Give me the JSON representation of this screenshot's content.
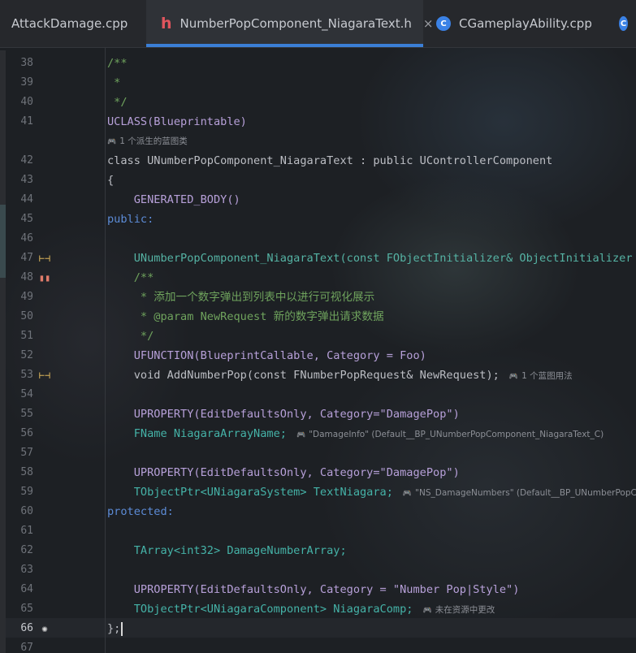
{
  "tabs": [
    {
      "label": "AttackDamage.cpp",
      "icon": "none",
      "active": false
    },
    {
      "label": "NumberPopComponent_NiagaraText.h",
      "icon": "h-icon",
      "active": true,
      "close": "×"
    },
    {
      "label": "CGameplayAbility.cpp",
      "icon": "cpp-icon",
      "active": false
    },
    {
      "label": "",
      "icon": "cpp-icon",
      "active": false
    }
  ],
  "lines": [
    {
      "n": "38",
      "text": "/**"
    },
    {
      "n": "39",
      "text": " *"
    },
    {
      "n": "40",
      "text": " */"
    },
    {
      "n": "41",
      "text": "UCLASS(Blueprintable)"
    },
    {
      "hint": "1 个派生的蓝图类"
    },
    {
      "n": "42",
      "text": "class UNumberPopComponent_NiagaraText : public UControllerComponent"
    },
    {
      "n": "43",
      "text": "{"
    },
    {
      "n": "44",
      "text": "    GENERATED_BODY()"
    },
    {
      "n": "45",
      "text": "public:"
    },
    {
      "n": "46",
      "text": ""
    },
    {
      "n": "47",
      "text": "    UNumberPopComponent_NiagaraText(const FObjectInitializer& ObjectInitializer = "
    },
    {
      "n": "48",
      "text": "    /**"
    },
    {
      "n": "49",
      "text": "     * 添加一个数字弹出到列表中以进行可视化展示"
    },
    {
      "n": "50",
      "text": "     * @param NewRequest 新的数字弹出请求数据"
    },
    {
      "n": "51",
      "text": "     */"
    },
    {
      "n": "52",
      "text": "    UFUNCTION(BlueprintCallable, Category = Foo)"
    },
    {
      "n": "53",
      "text": "    void AddNumberPop(const FNumberPopRequest& NewRequest);",
      "inlay": "1 个蓝图用法"
    },
    {
      "n": "54",
      "text": ""
    },
    {
      "n": "55",
      "text": "    UPROPERTY(EditDefaultsOnly, Category=\"DamagePop\")"
    },
    {
      "n": "56",
      "text": "    FName NiagaraArrayName;",
      "inlay": "\"DamageInfo\" (Default__BP_UNumberPopComponent_NiagaraText_C)"
    },
    {
      "n": "57",
      "text": ""
    },
    {
      "n": "58",
      "text": "    UPROPERTY(EditDefaultsOnly, Category=\"DamagePop\")"
    },
    {
      "n": "59",
      "text": "    TObjectPtr<UNiagaraSystem> TextNiagara;",
      "inlay": "\"NS_DamageNumbers\" (Default__BP_UNumberPopCo"
    },
    {
      "n": "60",
      "text": "protected:"
    },
    {
      "n": "61",
      "text": ""
    },
    {
      "n": "62",
      "text": "    TArray<int32> DamageNumberArray;"
    },
    {
      "n": "63",
      "text": ""
    },
    {
      "n": "64",
      "text": "    UPROPERTY(EditDefaultsOnly, Category = \"Number Pop|Style\")"
    },
    {
      "n": "65",
      "text": "    TObjectPtr<UNiagaraComponent> NiagaraComp;",
      "inlay": "未在资源中更改"
    },
    {
      "n": "66",
      "text": "};"
    },
    {
      "n": "67",
      "text": ""
    }
  ]
}
